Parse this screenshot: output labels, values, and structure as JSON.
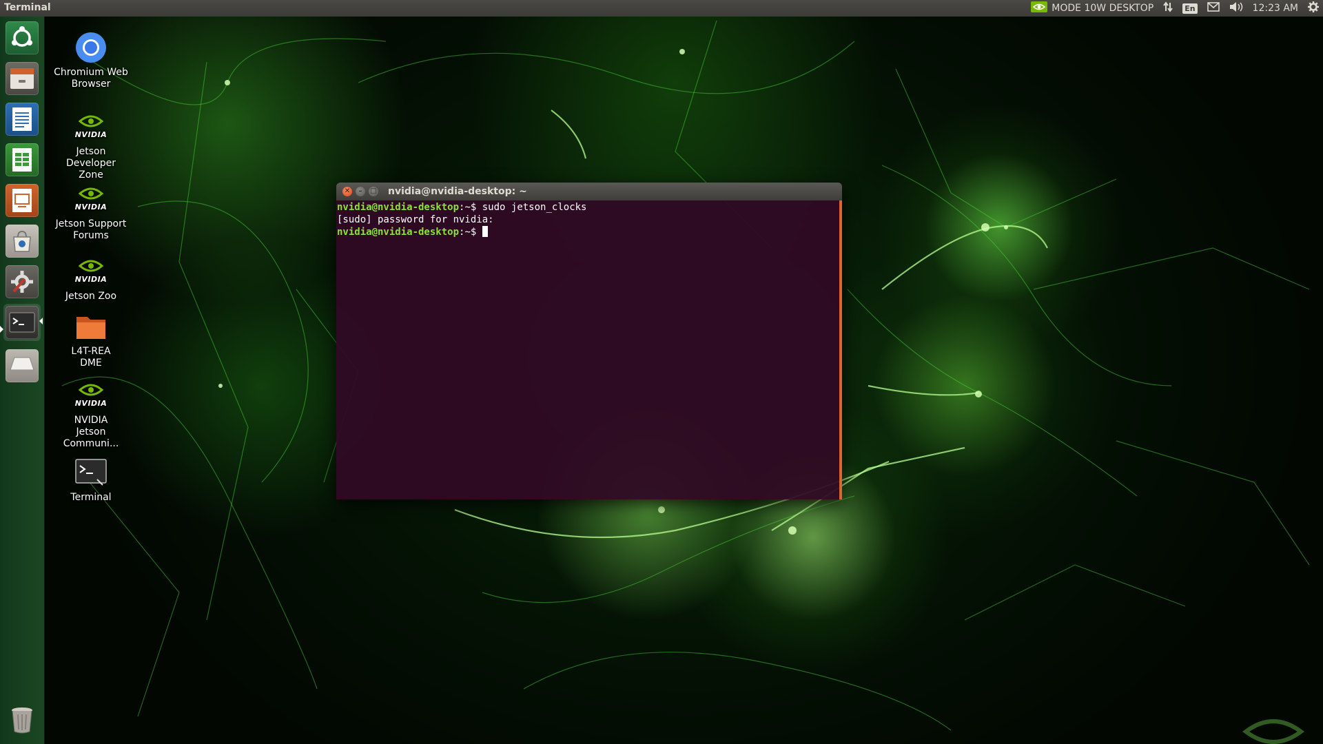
{
  "top_panel": {
    "app_title": "Terminal",
    "power_mode": "MODE 10W DESKTOP",
    "keyboard_layout": "En",
    "clock": "12:23 AM",
    "icons": [
      "nvidia-icon",
      "network-icon",
      "keyboard-icon",
      "mail-icon",
      "volume-icon",
      "gear-icon"
    ]
  },
  "launcher": {
    "items": [
      {
        "name": "dash-home",
        "icon": "ubuntu-icon"
      },
      {
        "name": "files",
        "icon": "file-manager-icon"
      },
      {
        "name": "writer",
        "icon": "libreoffice-writer-icon"
      },
      {
        "name": "calc",
        "icon": "libreoffice-calc-icon"
      },
      {
        "name": "impress",
        "icon": "libreoffice-impress-icon"
      },
      {
        "name": "software",
        "icon": "software-center-icon"
      },
      {
        "name": "settings",
        "icon": "system-settings-icon"
      },
      {
        "name": "terminal",
        "icon": "terminal-icon",
        "active": true
      },
      {
        "name": "disk",
        "icon": "disk-drive-icon"
      },
      {
        "name": "trash",
        "icon": "trash-icon"
      }
    ]
  },
  "desktop_icons": [
    {
      "label": "Chromium Web Browser",
      "icon": "chromium-icon"
    },
    {
      "label": "Jetson Developer Zone",
      "icon": "nvidia-logo-icon"
    },
    {
      "label": "Jetson Support Forums",
      "icon": "nvidia-logo-icon"
    },
    {
      "label": "Jetson Zoo",
      "icon": "nvidia-logo-icon"
    },
    {
      "label": "L4T-README",
      "icon": "folder-icon"
    },
    {
      "label": "NVIDIA Jetson Communi...",
      "icon": "nvidia-logo-icon"
    },
    {
      "label": "Terminal",
      "icon": "terminal-icon"
    }
  ],
  "nvidia_word": "NVIDIA",
  "terminal": {
    "title": "nvidia@nvidia-desktop: ~",
    "lines": [
      {
        "user_host": "nvidia@nvidia-desktop",
        "colon": ":",
        "path": "~",
        "symbol": "$",
        "command": " sudo jetson_clocks"
      },
      {
        "text": "[sudo] password for nvidia:"
      },
      {
        "user_host": "nvidia@nvidia-desktop",
        "colon": ":",
        "path": "~",
        "symbol": "$",
        "command": " "
      }
    ]
  },
  "colors": {
    "terminal_bg": "#300a24",
    "prompt_green": "#8ae234",
    "panel_bg": "#3c3b37",
    "close_button": "#df4a16"
  }
}
